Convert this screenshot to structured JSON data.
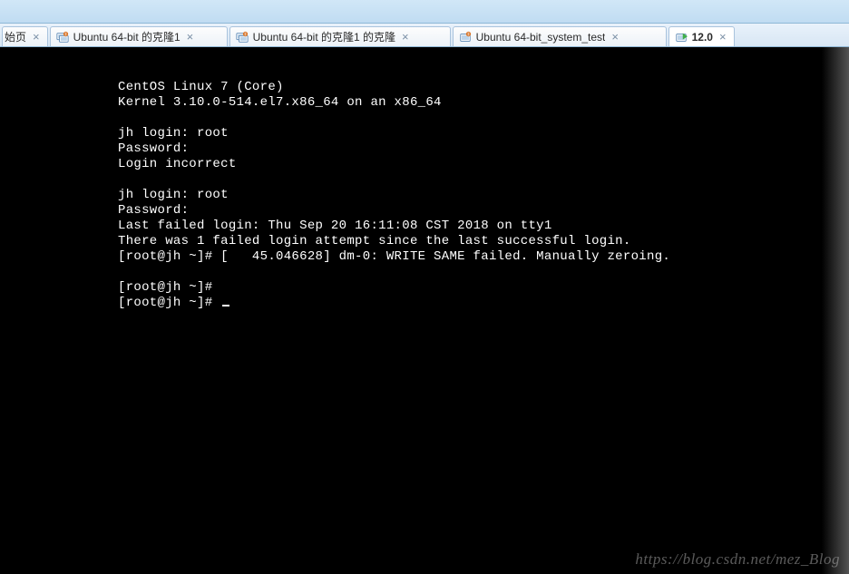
{
  "tabs": [
    {
      "label": "始页",
      "icon": "home"
    },
    {
      "label": "Ubuntu 64-bit 的克隆1",
      "icon": "vm"
    },
    {
      "label": "Ubuntu 64-bit 的克隆1 的克隆",
      "icon": "vm"
    },
    {
      "label": "Ubuntu 64-bit_system_test",
      "icon": "vm"
    },
    {
      "label": "12.0",
      "icon": "vm-active",
      "active": true
    }
  ],
  "terminal": {
    "lines": [
      "CentOS Linux 7 (Core)",
      "Kernel 3.10.0-514.el7.x86_64 on an x86_64",
      "",
      "jh login: root",
      "Password:",
      "Login incorrect",
      "",
      "jh login: root",
      "Password:",
      "Last failed login: Thu Sep 20 16:11:08 CST 2018 on tty1",
      "There was 1 failed login attempt since the last successful login.",
      "[root@jh ~]# [   45.046628] dm-0: WRITE SAME failed. Manually zeroing.",
      "",
      "[root@jh ~]#",
      "[root@jh ~]# "
    ]
  },
  "watermark": "https://blog.csdn.net/mez_Blog",
  "closeGlyph": "×"
}
